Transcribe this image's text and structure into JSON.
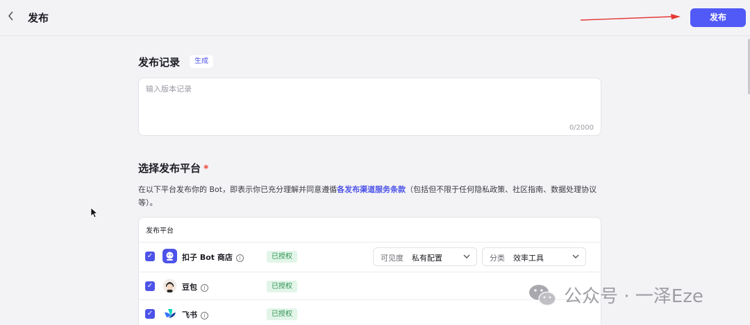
{
  "header": {
    "back_icon": "chevron-left-icon",
    "title": "发布",
    "publish_label": "发布"
  },
  "record": {
    "title": "发布记录",
    "generate_label": "生成",
    "placeholder": "输入版本记录",
    "counter": "0/2000"
  },
  "platforms": {
    "title": "选择发布平台",
    "required_mark": "*",
    "desc_before": "在以下平台发布你的 Bot，即表示你已充分理解并同意遵循",
    "desc_link": "各发布渠道服务条款",
    "desc_after": "（包括但不限于任何隐私政策、社区指南、数据处理协议等）。",
    "table_header": "发布平台",
    "rows": [
      {
        "name": "扣子 Bot 商店",
        "status": "已授权",
        "checked": true,
        "visibility_label": "可见度",
        "visibility_value": "私有配置",
        "category_label": "分类",
        "category_value": "效率工具"
      },
      {
        "name": "豆包",
        "status": "已授权",
        "checked": true
      },
      {
        "name": "飞书",
        "status": "已授权",
        "checked": true
      }
    ]
  },
  "watermark": {
    "text": "公众号 · 一泽Eze"
  },
  "colors": {
    "accent": "#5159f6",
    "badge_bg": "#e2f5e8",
    "badge_text": "#2f9453",
    "arrow": "#e53935"
  }
}
